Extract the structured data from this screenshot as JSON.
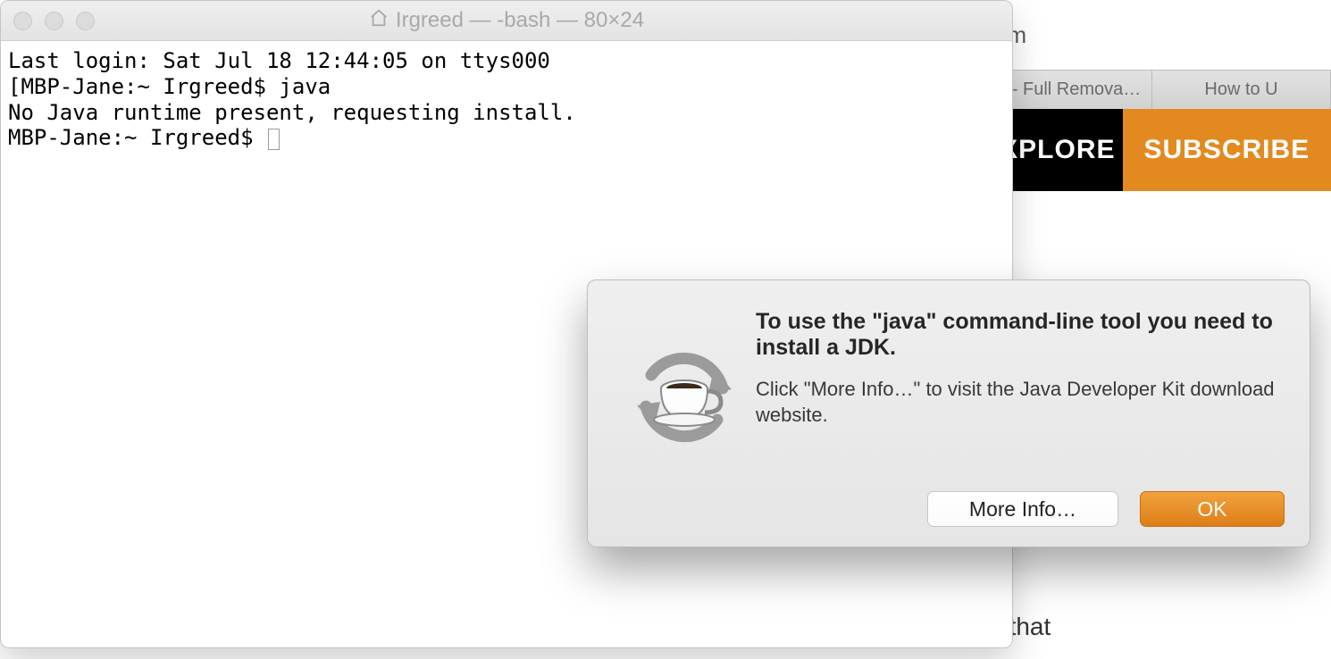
{
  "browser": {
    "address_fragment": "com",
    "tabs": [
      "lac - Full Remova…",
      "How to U"
    ],
    "nav": {
      "explore": "EXPLORE",
      "subscribe": "SUBSCRIBE"
    },
    "body_fragment": "ig that"
  },
  "terminal": {
    "title": "Irgreed — -bash — 80×24",
    "lines": [
      "Last login: Sat Jul 18 12:44:05 on ttys000",
      "[MBP-Jane:~ Irgreed$ java",
      "No Java runtime present, requesting install.",
      "MBP-Jane:~ Irgreed$ "
    ]
  },
  "dialog": {
    "title": "To use the \"java\" command-line tool you need to install a JDK.",
    "description": "Click \"More Info…\" to visit the Java Developer Kit download website.",
    "buttons": {
      "more_info": "More Info…",
      "ok": "OK"
    },
    "icon": "java-update-icon"
  }
}
